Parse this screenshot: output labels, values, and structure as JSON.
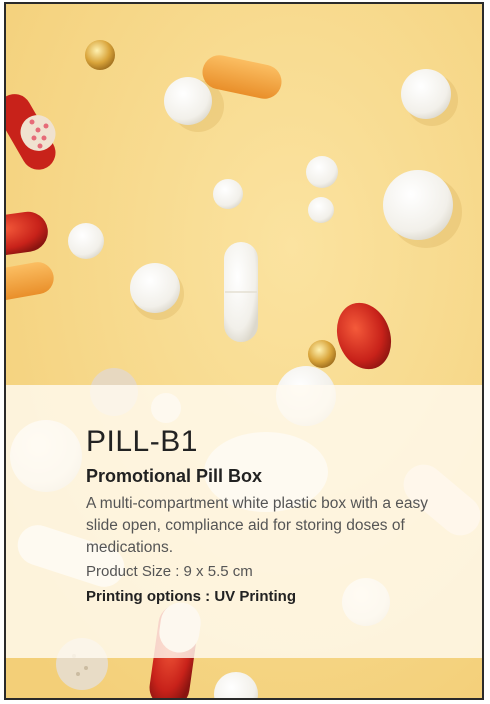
{
  "product": {
    "code": "PILL-B1",
    "name": "Promotional Pill Box",
    "description": "A multi-compartment white plastic box with a easy slide open, compliance aid for storing doses of medications.",
    "size": "Product Size : 9 x 5.5 cm",
    "printing": "Printing options : UV Printing"
  },
  "colors": {
    "background": "#f7d98c",
    "panel": "#fffaf0",
    "capsule_orange": "#f4a640",
    "capsule_red": "#c8221a",
    "pill_white": "#fbfbf8"
  },
  "images": {
    "photo": "pills-and-capsules-photo"
  }
}
